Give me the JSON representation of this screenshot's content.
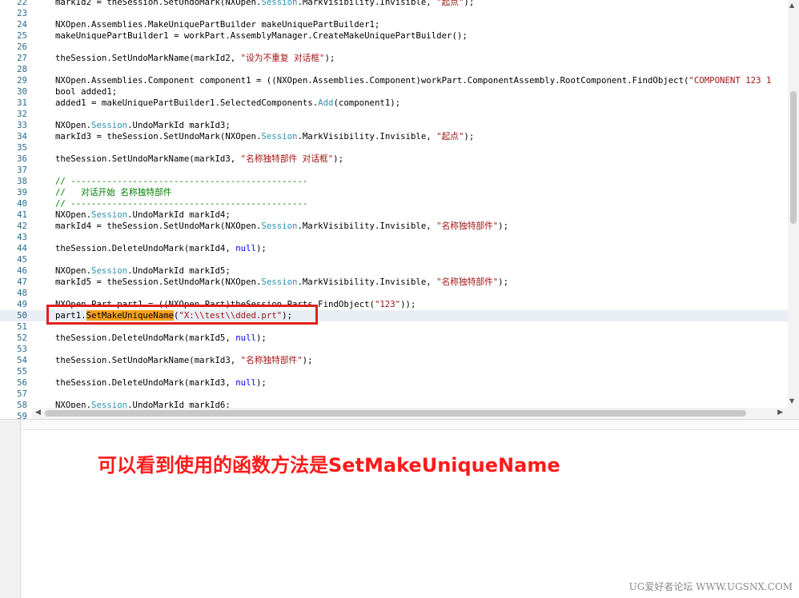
{
  "editor": {
    "lines": [
      {
        "num": "22",
        "code": "markId2 = theSession.SetUndoMark(NXOpen.Session.MarkVisibility.Invisible, \"起点\");"
      },
      {
        "num": "23",
        "code": ""
      },
      {
        "num": "24",
        "code": "NXOpen.Assemblies.MakeUniquePartBuilder makeUniquePartBuilder1;"
      },
      {
        "num": "25",
        "code": "makeUniquePartBuilder1 = workPart.AssemblyManager.CreateMakeUniquePartBuilder();"
      },
      {
        "num": "26",
        "code": ""
      },
      {
        "num": "27",
        "code": "theSession.SetUndoMarkName(markId2, \"设为不重复 对话框\");"
      },
      {
        "num": "28",
        "code": ""
      },
      {
        "num": "29",
        "code": "NXOpen.Assemblies.Component component1 = ((NXOpen.Assemblies.Component)workPart.ComponentAssembly.RootComponent.FindObject(\"COMPONENT 123 1"
      },
      {
        "num": "30",
        "code": "bool added1;"
      },
      {
        "num": "31",
        "code": "added1 = makeUniquePartBuilder1.SelectedComponents.Add(component1);"
      },
      {
        "num": "32",
        "code": ""
      },
      {
        "num": "33",
        "code": "NXOpen.Session.UndoMarkId markId3;"
      },
      {
        "num": "34",
        "code": "markId3 = theSession.SetUndoMark(NXOpen.Session.MarkVisibility.Invisible, \"起点\");"
      },
      {
        "num": "35",
        "code": ""
      },
      {
        "num": "36",
        "code": "theSession.SetUndoMarkName(markId3, \"名称独特部件 对话框\");"
      },
      {
        "num": "37",
        "code": ""
      },
      {
        "num": "38",
        "code": "// ----------------------------------------------"
      },
      {
        "num": "39",
        "code": "//   对话开始 名称独特部件"
      },
      {
        "num": "40",
        "code": "// ----------------------------------------------"
      },
      {
        "num": "41",
        "code": "NXOpen.Session.UndoMarkId markId4;"
      },
      {
        "num": "42",
        "code": "markId4 = theSession.SetUndoMark(NXOpen.Session.MarkVisibility.Invisible, \"名称独特部件\");"
      },
      {
        "num": "43",
        "code": ""
      },
      {
        "num": "44",
        "code": "theSession.DeleteUndoMark(markId4, null);"
      },
      {
        "num": "45",
        "code": ""
      },
      {
        "num": "46",
        "code": "NXOpen.Session.UndoMarkId markId5;"
      },
      {
        "num": "47",
        "code": "markId5 = theSession.SetUndoMark(NXOpen.Session.MarkVisibility.Invisible, \"名称独特部件\");"
      },
      {
        "num": "48",
        "code": ""
      },
      {
        "num": "49",
        "code": "NXOpen.Part part1 = ((NXOpen.Part)theSession.Parts.FindObject(\"123\"));"
      },
      {
        "num": "50",
        "code": "part1.SetMakeUniqueName(\"X:\\\\test\\\\dded.prt\");",
        "current": true
      },
      {
        "num": "51",
        "code": ""
      },
      {
        "num": "52",
        "code": "theSession.DeleteUndoMark(markId5, null);"
      },
      {
        "num": "53",
        "code": ""
      },
      {
        "num": "54",
        "code": "theSession.SetUndoMarkName(markId3, \"名称独特部件\");"
      },
      {
        "num": "55",
        "code": ""
      },
      {
        "num": "56",
        "code": "theSession.DeleteUndoMark(markId3, null);"
      },
      {
        "num": "57",
        "code": ""
      },
      {
        "num": "58",
        "code": "NXOpen.Session.UndoMarkId markId6;"
      },
      {
        "num": "59",
        "code": ""
      }
    ],
    "highlight_word": "SetMakeUniqueName"
  },
  "colors": {
    "string": "#a31515",
    "type": "#2b91af",
    "keyword": "#0000ff",
    "comment": "#008000",
    "annotation": "#ff1a1a",
    "highlight_box": "#e0201e",
    "word_highlight": "#f6a21b"
  },
  "scrollbars": {
    "up_icon": "▲",
    "down_icon": "▼",
    "left_icon": "◀",
    "right_icon": "▶"
  },
  "annotation": {
    "text": "可以看到使用的函数方法是SetMakeUniqueName"
  },
  "watermark": {
    "text": "UG爱好者论坛 WWW.UGSNX.COM"
  }
}
